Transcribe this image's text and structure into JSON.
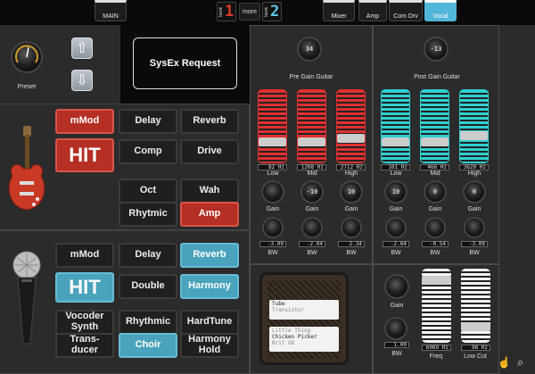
{
  "topbar": {
    "main_tab": "MAIN",
    "bank_left_label": "bank",
    "bank_left_num": "1",
    "more": "more",
    "bank_right_label": "bank",
    "bank_right_num": "2",
    "tabs": [
      {
        "label": "Mixer",
        "active": false
      },
      {
        "label": "Amp",
        "active": false
      },
      {
        "label": "Com Drv",
        "active": false
      },
      {
        "label": "Vocal",
        "active": true
      }
    ]
  },
  "preset": {
    "label": "Preset"
  },
  "sysex": {
    "label": "SysEx Request"
  },
  "guitar_buttons": [
    {
      "label": "mMod",
      "style": "red"
    },
    {
      "label": "Delay",
      "style": "dark"
    },
    {
      "label": "Reverb",
      "style": "dark"
    },
    {
      "label": "HIT",
      "style": "red-big"
    },
    {
      "label": "Comp",
      "style": "dark"
    },
    {
      "label": "Drive",
      "style": "dark"
    },
    {
      "label": "Oct",
      "style": "dark"
    },
    {
      "label": "Wah",
      "style": "dark"
    },
    {
      "label": "Rhytmic",
      "style": "dark"
    },
    {
      "label": "Amp",
      "style": "red"
    }
  ],
  "vocal_buttons": [
    {
      "label": "mMod",
      "style": "dark"
    },
    {
      "label": "Delay",
      "style": "dark"
    },
    {
      "label": "Reverb",
      "style": "blue"
    },
    {
      "label": "HIT",
      "style": "blue-big"
    },
    {
      "label": "Double",
      "style": "dark"
    },
    {
      "label": "Harmony",
      "style": "blue"
    },
    {
      "label": "Vocoder Synth",
      "style": "dark"
    },
    {
      "label": "Rhythmic",
      "style": "dark"
    },
    {
      "label": "HardTune",
      "style": "dark"
    },
    {
      "label": "Trans-ducer",
      "style": "dark"
    },
    {
      "label": "Choir",
      "style": "blue"
    },
    {
      "label": "Harmony Hold",
      "style": "dark"
    }
  ],
  "pre_eq": {
    "knob_value": "34",
    "title": "Pre Gain Guitar",
    "color": "#e03030",
    "bands": [
      {
        "freq": "82 Hz",
        "name": "Low",
        "level": 0.25,
        "gain_value": "",
        "bw": "-3.09"
      },
      {
        "freq": "1208 Hz",
        "name": "Mid",
        "level": 0.25,
        "gain_value": "-10",
        "bw": "-2.04"
      },
      {
        "freq": "2712 Hz",
        "name": "High",
        "level": 0.3,
        "gain_value": "10",
        "bw": "2.34"
      }
    ],
    "gain_label": "Gain",
    "bw_label": "BW"
  },
  "post_eq": {
    "knob_value": "-13",
    "title": "Post Gain Guitar",
    "color": "#30d0d0",
    "bands": [
      {
        "freq": "101 Hz",
        "name": "Low",
        "level": 0.25,
        "gain_value": "10",
        "bw": "-2.04"
      },
      {
        "freq": "466 Hz",
        "name": "Mid",
        "level": 0.25,
        "gain_value": "0",
        "bw": "-0.54"
      },
      {
        "freq": "3620 Hz",
        "name": "High",
        "level": 0.35,
        "gain_value": "0",
        "bw": "-3.09"
      }
    ],
    "gain_label": "Gain",
    "bw_label": "BW"
  },
  "amp_sim": {
    "line1": "Tube",
    "line2": "Transistor",
    "line3": "Little Thing",
    "line4": "Chicken Picker",
    "line5": "Brit OD"
  },
  "vocal_eq": {
    "gain_label": "Gain",
    "bw_label": "BW",
    "bw_value": "1.00",
    "freq_value": "6089 Hz",
    "freq_label": "Freq",
    "lowcut_value": "98 Hz",
    "lowcut_label": "Low Cut"
  }
}
